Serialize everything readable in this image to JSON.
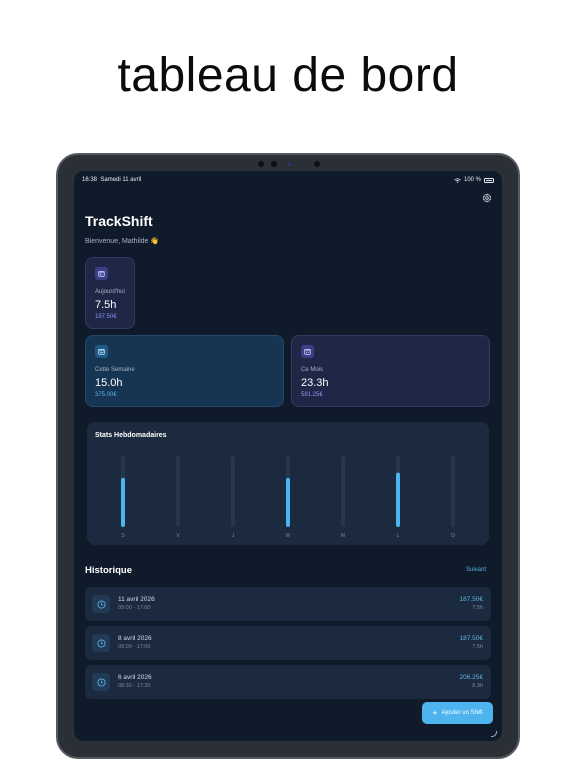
{
  "headline": "tableau de bord",
  "status_bar": {
    "time": "16:38",
    "date": "Samedi 11 avril",
    "battery": "100 %"
  },
  "app": {
    "title": "TrackShift",
    "welcome": "Bienvenue, Mathilde 👋"
  },
  "cards": [
    {
      "label": "Aujourd'hui",
      "hours": "7.5h",
      "money": "187.50€",
      "icon": "calendar-day-icon"
    },
    {
      "label": "Cette Semaine",
      "hours": "15.0h",
      "money": "375.00€",
      "icon": "calendar-week-icon"
    },
    {
      "label": "Ce Mois",
      "hours": "23.3h",
      "money": "581.25€",
      "icon": "calendar-month-icon"
    }
  ],
  "colors": {
    "accent": "#4db4ef",
    "card_money_today": "#8b8ff7",
    "card_money_week": "#5bb3e6",
    "card_money_month": "#a08cf5"
  },
  "chart_data": {
    "type": "bar",
    "title": "Stats Hebdomadaires",
    "categories": [
      "S",
      "V",
      "J",
      "M",
      "M",
      "L",
      "D"
    ],
    "values": [
      7.5,
      0,
      0,
      7.5,
      0,
      8.3,
      0
    ],
    "ylim": [
      0,
      11
    ]
  },
  "history": {
    "title": "Historique",
    "next_label": "Suivant",
    "items": [
      {
        "date": "11 avril 2026",
        "range": "09:00 - 17:00",
        "amount": "187.50€",
        "duration": "7.5h"
      },
      {
        "date": "8 avril 2026",
        "range": "09:00 - 17:00",
        "amount": "187.50€",
        "duration": "7.5h"
      },
      {
        "date": "6 avril 2026",
        "range": "08:30 - 17:30",
        "amount": "206.25€",
        "duration": "8.3h"
      }
    ]
  },
  "add_button": {
    "label": "Ajouter un Shift"
  }
}
